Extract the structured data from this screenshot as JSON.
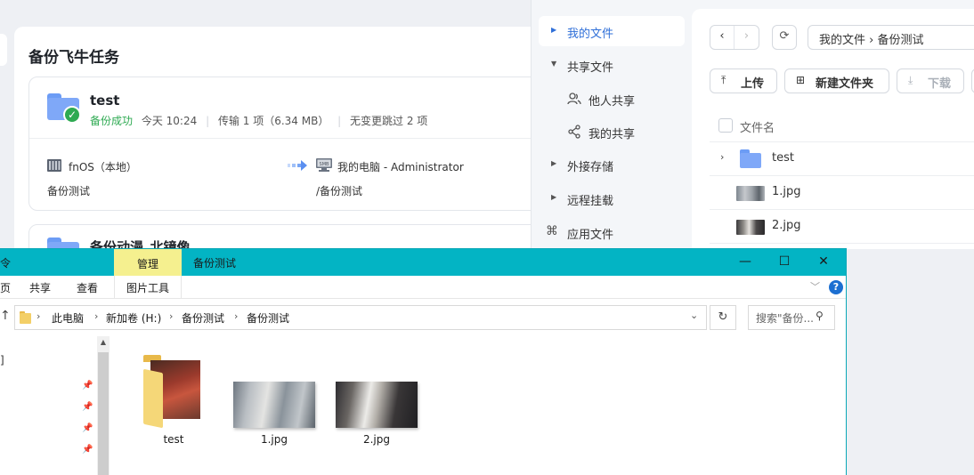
{
  "backup_panel": {
    "title": "备份飞牛任务",
    "task": {
      "name": "test",
      "status": "备份成功",
      "time": "今天 10:24",
      "transfer": "传输 1 项（6.34 MB）",
      "skipped": "无变更跳过 2 项",
      "source_name": "fnOS（本地）",
      "source_path": "备份测试",
      "dest_name": "我的电脑 - Administrator",
      "dest_path": "/备份测试",
      "dest_badge": "SMB"
    },
    "task2": {
      "name": "备份动漫_北镜像"
    }
  },
  "file_manager": {
    "sidebar": [
      {
        "label": "我的文件",
        "active": true
      },
      {
        "label": "共享文件"
      },
      {
        "label": "他人共享",
        "icon": "users-icon"
      },
      {
        "label": "我的共享",
        "icon": "share-icon"
      },
      {
        "label": "外接存储"
      },
      {
        "label": "远程挂载"
      },
      {
        "label": "应用文件",
        "icon": "command-icon"
      }
    ],
    "breadcrumb": "我的文件 › 备份测试",
    "buttons": {
      "upload": "上传",
      "new_folder": "新建文件夹",
      "download": "下载"
    },
    "column_header": "文件名",
    "files": [
      {
        "name": "test",
        "type": "folder"
      },
      {
        "name": "1.jpg",
        "type": "image"
      },
      {
        "name": "2.jpg",
        "type": "image"
      }
    ]
  },
  "explorer": {
    "title_stub": "令",
    "manage_tab": "管理",
    "title": "备份测试",
    "controls": {
      "minimize": "—",
      "maximize": "☐",
      "close": "✕"
    },
    "ribbon": {
      "stub": "页",
      "share": "共享",
      "view": "查看",
      "picture_tools": "图片工具"
    },
    "address": [
      "此电脑",
      "新加卷 (H:)",
      "备份测试",
      "备份测试"
    ],
    "search_placeholder": "搜索\"备份...",
    "nav_stub": "]",
    "items": [
      {
        "name": "test",
        "type": "folder"
      },
      {
        "name": "1.jpg",
        "type": "image"
      },
      {
        "name": "2.jpg",
        "type": "image"
      }
    ]
  },
  "colors": {
    "accent_blue": "#2f6fd8",
    "success_green": "#2eaa52",
    "win_titlebar": "#03b4c4",
    "manage_tab": "#f5f08f"
  }
}
